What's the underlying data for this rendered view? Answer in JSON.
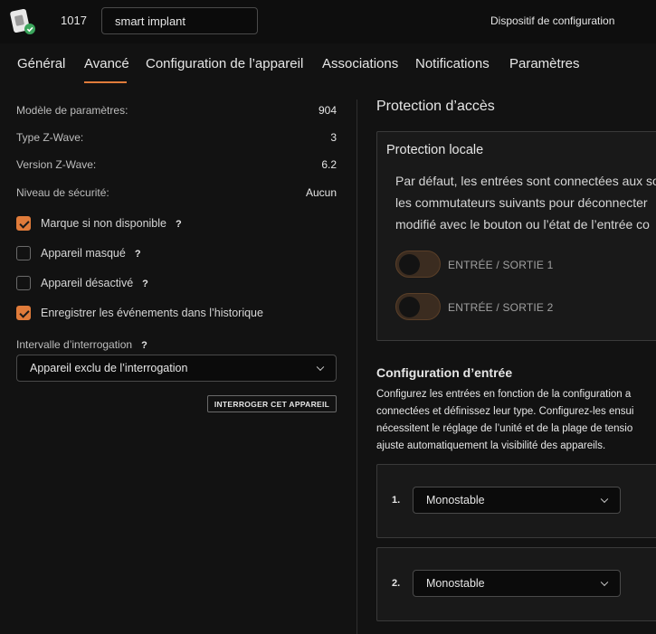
{
  "header": {
    "device_id": "1017",
    "name_value": "smart implant",
    "config_title": "Dispositif de configuration"
  },
  "tabs": [
    {
      "label": "Général"
    },
    {
      "label": "Avancé",
      "active": true
    },
    {
      "label": "Configuration de l’appareil"
    },
    {
      "label": "Associations"
    },
    {
      "label": "Notifications"
    },
    {
      "label": "Paramètres"
    }
  ],
  "info": [
    {
      "key": "Modèle de paramètres:",
      "value": "904"
    },
    {
      "key": "Type Z-Wave:",
      "value": "3"
    },
    {
      "key": "Version Z-Wave:",
      "value": "6.2"
    },
    {
      "key": "Niveau de sécurité:",
      "value": "Aucun"
    }
  ],
  "checkboxes": [
    {
      "label": "Marque si non disponible",
      "checked": true,
      "help": "?"
    },
    {
      "label": "Appareil masqué",
      "checked": false,
      "help": "?"
    },
    {
      "label": "Appareil désactivé",
      "checked": false,
      "help": "?"
    },
    {
      "label": "Enregistrer les événements dans l’historique",
      "checked": true
    }
  ],
  "polling": {
    "label": "Intervalle d’interrogation",
    "help": "?",
    "value": "Appareil exclu de l’interrogation",
    "button": "INTERROGER CET APPAREIL"
  },
  "protection": {
    "title": "Protection d’accès",
    "local_title": "Protection locale",
    "text": [
      "Par défaut, les entrées sont connectées aux so",
      "les commutateurs suivants pour déconnecter",
      "modifié avec le bouton ou l’état de l’entrée co"
    ],
    "toggles": [
      {
        "label": "ENTRÉE / SORTIE 1",
        "on": false
      },
      {
        "label": "ENTRÉE / SORTIE 2",
        "on": false
      }
    ]
  },
  "input_config": {
    "title": "Configuration d’entrée",
    "text": [
      "Configurez les entrées en fonction de la configuration a",
      "connectées et définissez leur type. Configurez-les ensui",
      "nécessitent le réglage de l’unité et de la plage de tensio",
      "ajuste automatiquement la visibilité des appareils."
    ],
    "inputs": [
      {
        "index": "1.",
        "value": "Monostable"
      },
      {
        "index": "2.",
        "value": "Monostable"
      }
    ]
  },
  "colors": {
    "accent": "#e07b3a",
    "background": "#121212",
    "topbar": "#0e0e0e",
    "card": "#191919"
  }
}
